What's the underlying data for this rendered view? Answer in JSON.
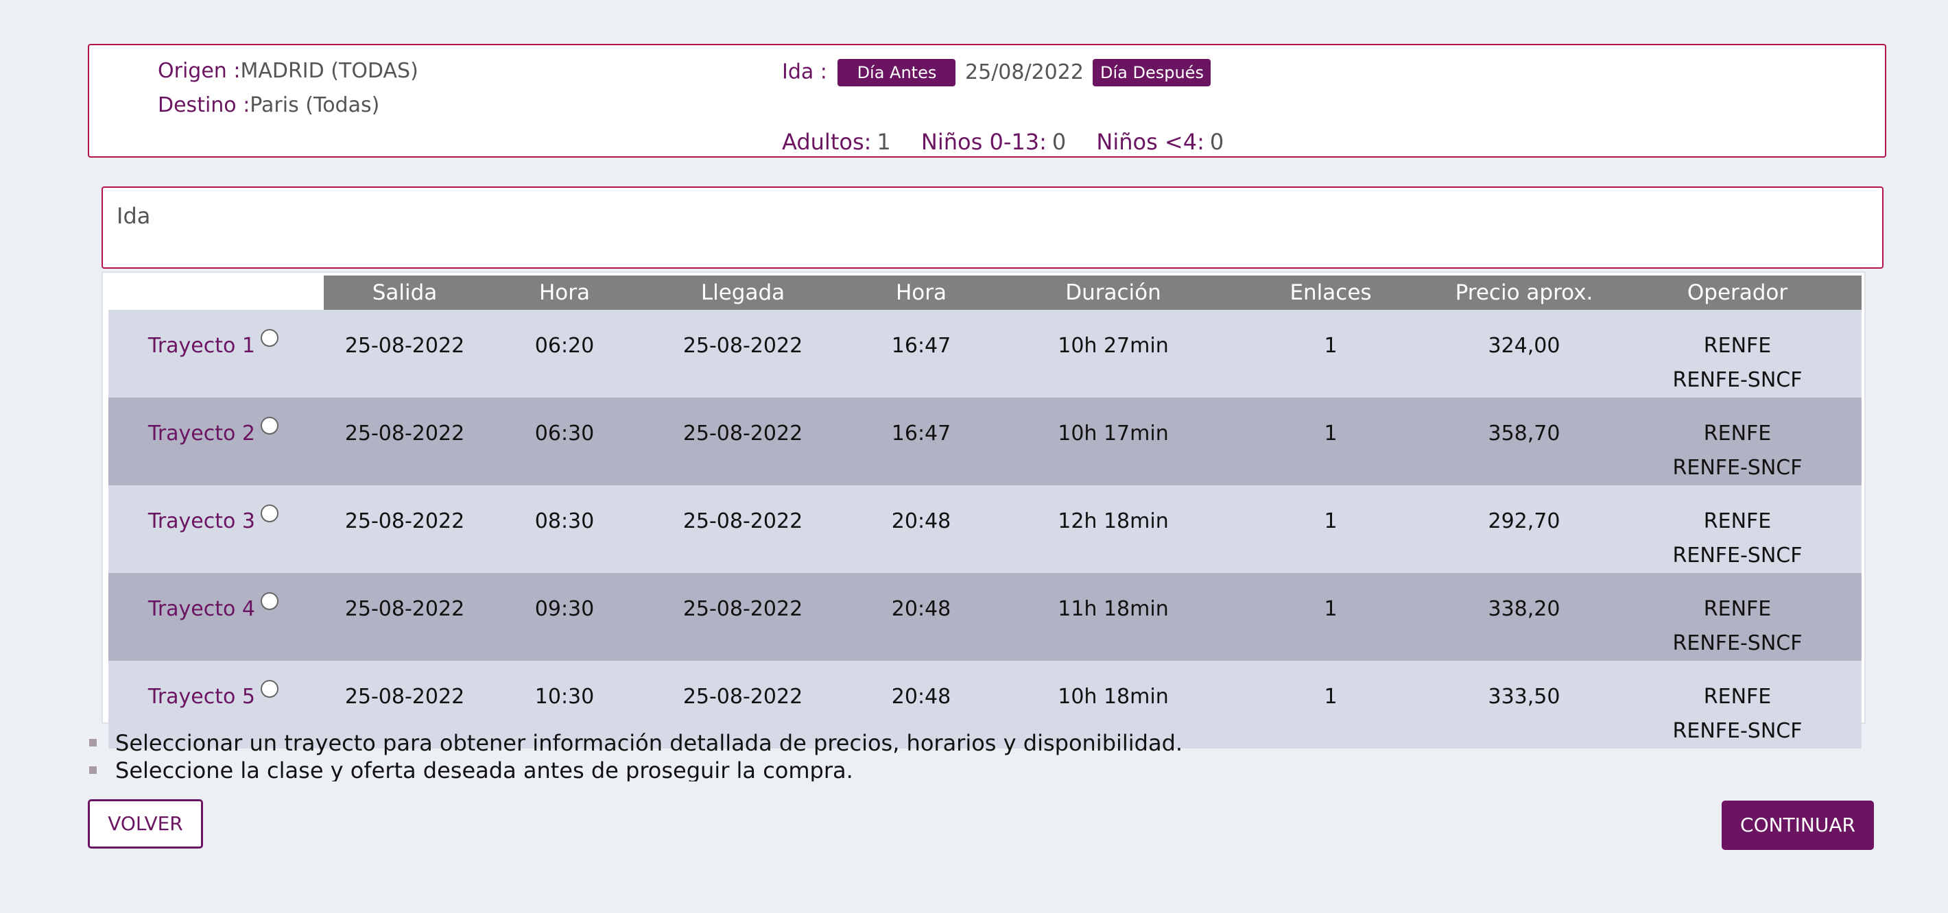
{
  "summary": {
    "origin_label": "Origen :",
    "origin_value": "MADRID (TODAS)",
    "destination_label": "Destino :",
    "destination_value": "Paris (Todas)",
    "ida_label": "Ida :",
    "prev_day_button": "Día Antes",
    "date": "25/08/2022",
    "next_day_button": "Día Después",
    "adults_label": "Adultos:",
    "adults_value": "1",
    "children_label": "Niños 0-13:",
    "children_value": "0",
    "infants_label": "Niños <4:",
    "infants_value": "0"
  },
  "section_title": "Ida",
  "table": {
    "headers": [
      "Salida",
      "Hora",
      "Llegada",
      "Hora",
      "Duración",
      "Enlaces",
      "Precio aprox.",
      "Operador"
    ],
    "rows": [
      {
        "label": "Trayecto 1",
        "salida": "25-08-2022",
        "hora_salida": "06:20",
        "llegada": "25-08-2022",
        "hora_llegada": "16:47",
        "duracion": "10h 27min",
        "enlaces": "1",
        "precio": "324,00",
        "operador_1": "RENFE",
        "operador_2": "RENFE-SNCF"
      },
      {
        "label": "Trayecto 2",
        "salida": "25-08-2022",
        "hora_salida": "06:30",
        "llegada": "25-08-2022",
        "hora_llegada": "16:47",
        "duracion": "10h 17min",
        "enlaces": "1",
        "precio": "358,70",
        "operador_1": "RENFE",
        "operador_2": "RENFE-SNCF"
      },
      {
        "label": "Trayecto 3",
        "salida": "25-08-2022",
        "hora_salida": "08:30",
        "llegada": "25-08-2022",
        "hora_llegada": "20:48",
        "duracion": "12h 18min",
        "enlaces": "1",
        "precio": "292,70",
        "operador_1": "RENFE",
        "operador_2": "RENFE-SNCF"
      },
      {
        "label": "Trayecto 4",
        "salida": "25-08-2022",
        "hora_salida": "09:30",
        "llegada": "25-08-2022",
        "hora_llegada": "20:48",
        "duracion": "11h 18min",
        "enlaces": "1",
        "precio": "338,20",
        "operador_1": "RENFE",
        "operador_2": "RENFE-SNCF"
      },
      {
        "label": "Trayecto 5",
        "salida": "25-08-2022",
        "hora_salida": "10:30",
        "llegada": "25-08-2022",
        "hora_llegada": "20:48",
        "duracion": "10h 18min",
        "enlaces": "1",
        "precio": "333,50",
        "operador_1": "RENFE",
        "operador_2": "RENFE-SNCF"
      }
    ]
  },
  "notes": [
    "Seleccionar un trayecto para obtener información detallada de precios, horarios y disponibilidad.",
    "Seleccione la clase y oferta deseada antes de proseguir la compra."
  ],
  "buttons": {
    "back": "VOLVER",
    "continue": "CONTINUAR"
  },
  "colors": {
    "brand": "#6b1461",
    "border": "#b5144a",
    "row_light": "#d6d9e6",
    "row_dark": "#b1b2c4",
    "header_bg": "#808080",
    "background": "#eceff4"
  }
}
